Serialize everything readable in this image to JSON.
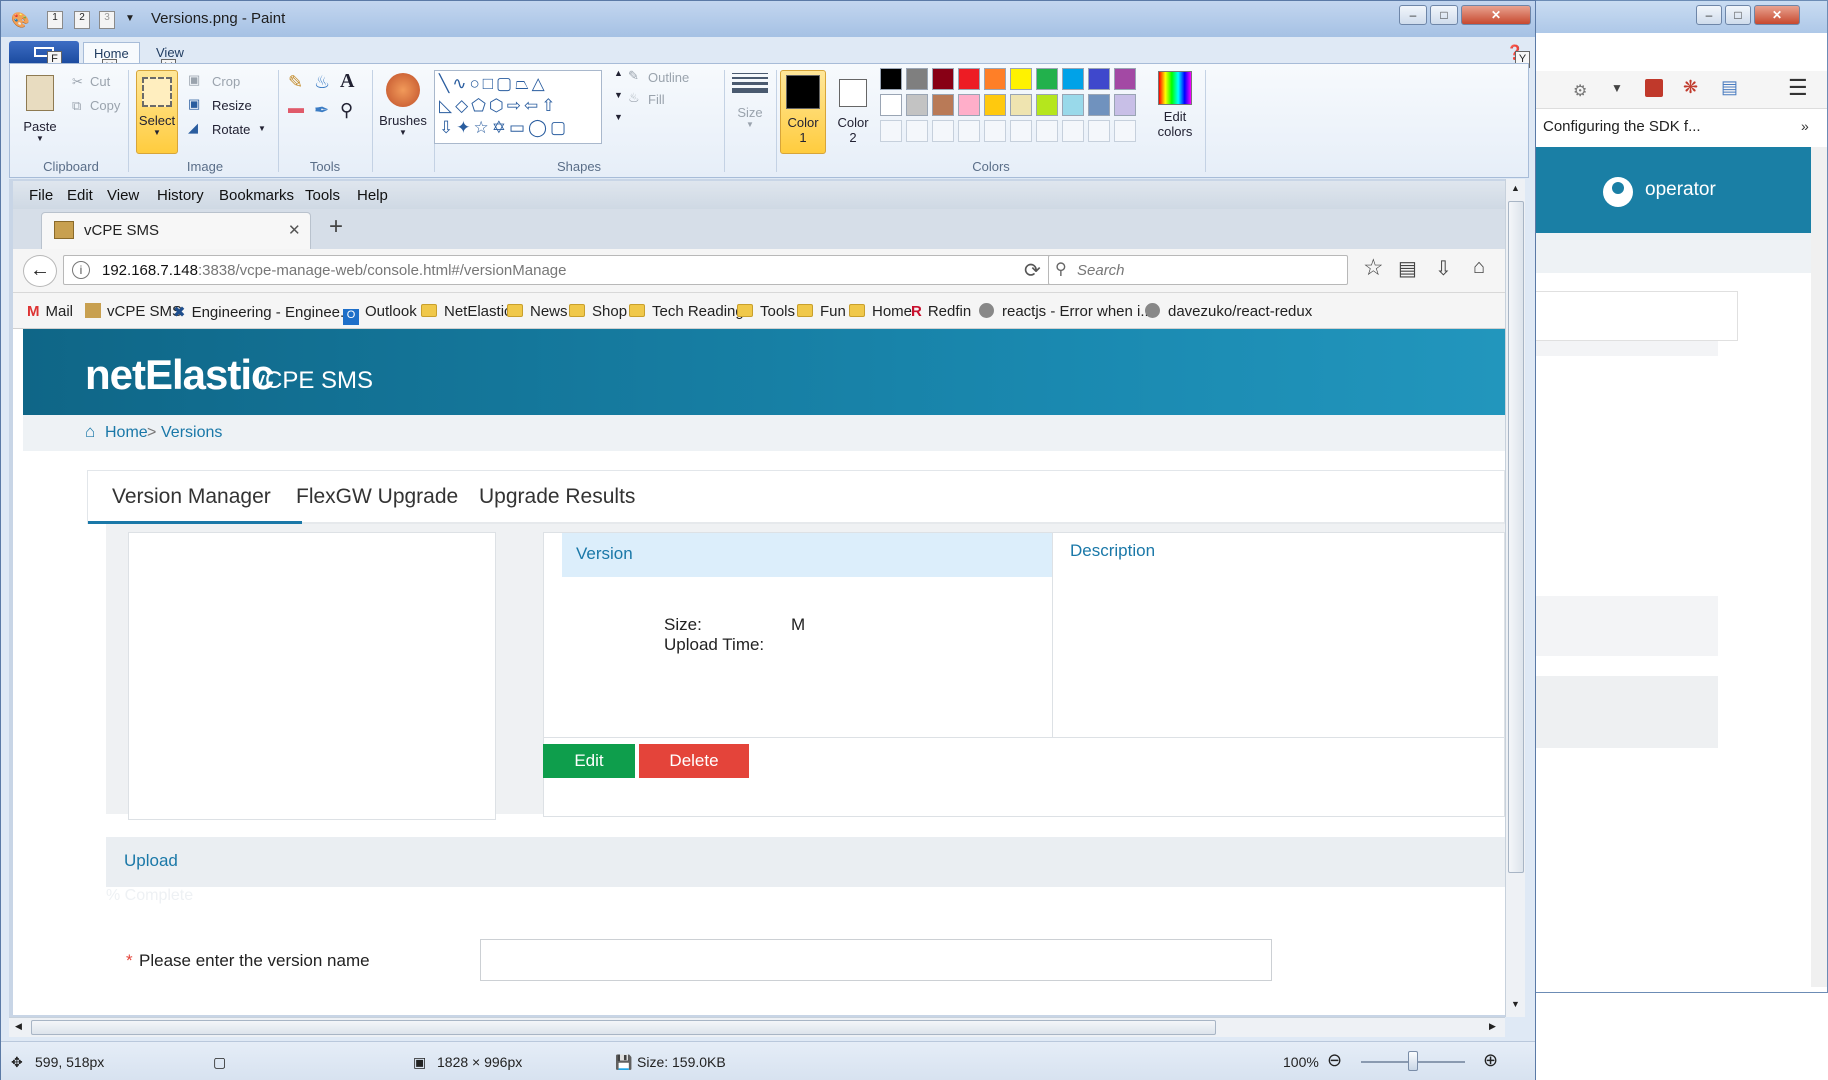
{
  "paint": {
    "title": "Versions.png - Paint",
    "qat_items": [
      "1",
      "2",
      "3"
    ],
    "keytips": {
      "file": "F",
      "home": "H",
      "view": "V",
      "help": "Y"
    },
    "tabs": {
      "home": "Home",
      "view": "View"
    },
    "clipboard": {
      "paste": "Paste",
      "cut": "Cut",
      "copy": "Copy",
      "group": "Clipboard"
    },
    "image": {
      "select": "Select",
      "crop": "Crop",
      "resize": "Resize",
      "rotate": "Rotate",
      "group": "Image"
    },
    "tools": {
      "group": "Tools"
    },
    "brushes": "Brushes",
    "shapes": {
      "outline": "Outline",
      "fill": "Fill",
      "group": "Shapes"
    },
    "size": "Size",
    "colors": {
      "color1_label": "Color",
      "color1_num": "1",
      "color2_label": "Color",
      "color2_num": "2",
      "edit_colors_1": "Edit",
      "edit_colors_2": "colors",
      "group": "Colors",
      "color1": "#000000",
      "color2": "#ffffff",
      "palette_row1": [
        "#000000",
        "#7f7f7f",
        "#880015",
        "#ed1c24",
        "#ff7f27",
        "#fff200",
        "#22b14c",
        "#00a2e8",
        "#3f48cc",
        "#a349a4"
      ],
      "palette_row2": [
        "#ffffff",
        "#c3c3c3",
        "#b97a57",
        "#ffaec9",
        "#ffc90e",
        "#efe4b0",
        "#b5e61d",
        "#99d9ea",
        "#7092be",
        "#c8bfe7"
      ]
    },
    "status": {
      "cursor": "599, 518px",
      "dimensions": "1828 × 996px",
      "size": "Size: 159.0KB",
      "zoom": "100%",
      "zoom_level": 1.0
    }
  },
  "background_window": {
    "tab_title": "Configuring the SDK f...",
    "user": "operator"
  },
  "firefox": {
    "menu": [
      "File",
      "Edit",
      "View",
      "History",
      "Bookmarks",
      "Tools",
      "Help"
    ],
    "tab_title": "vCPE SMS",
    "url_host": "192.168.7.148",
    "url_rest": ":3838/vcpe-manage-web/console.html#/versionManage",
    "search_placeholder": "Search",
    "bookmarks": [
      "Mail",
      "vCPE SMS",
      "Engineering - Enginee...",
      "Outlook",
      "NetElastic",
      "News",
      "Shop",
      "Tech Reading",
      "Tools",
      "Fun",
      "Home",
      "Redfin",
      "reactjs - Error when i...",
      "davezuko/react-redux"
    ]
  },
  "app": {
    "brand": "netElastic",
    "brand_sub": "vCPE SMS",
    "breadcrumb": {
      "home": "Home",
      "sep": ">",
      "current": "Versions"
    },
    "tabs": [
      "Version Manager",
      "FlexGW Upgrade",
      "Upgrade Results"
    ],
    "version_header": "Version",
    "description_header": "Description",
    "size_label": "Size:",
    "size_value": "M",
    "upload_time_label": "Upload Time:",
    "edit_button": "Edit",
    "delete_button": "Delete",
    "upload_title": "Upload",
    "ghost_text": "% Complete",
    "required_mark": "*",
    "version_name_label": "Please enter the version name",
    "colors": {
      "brand": "#1a78a8",
      "edit": "#0e9e4c",
      "delete": "#e4443a"
    }
  }
}
